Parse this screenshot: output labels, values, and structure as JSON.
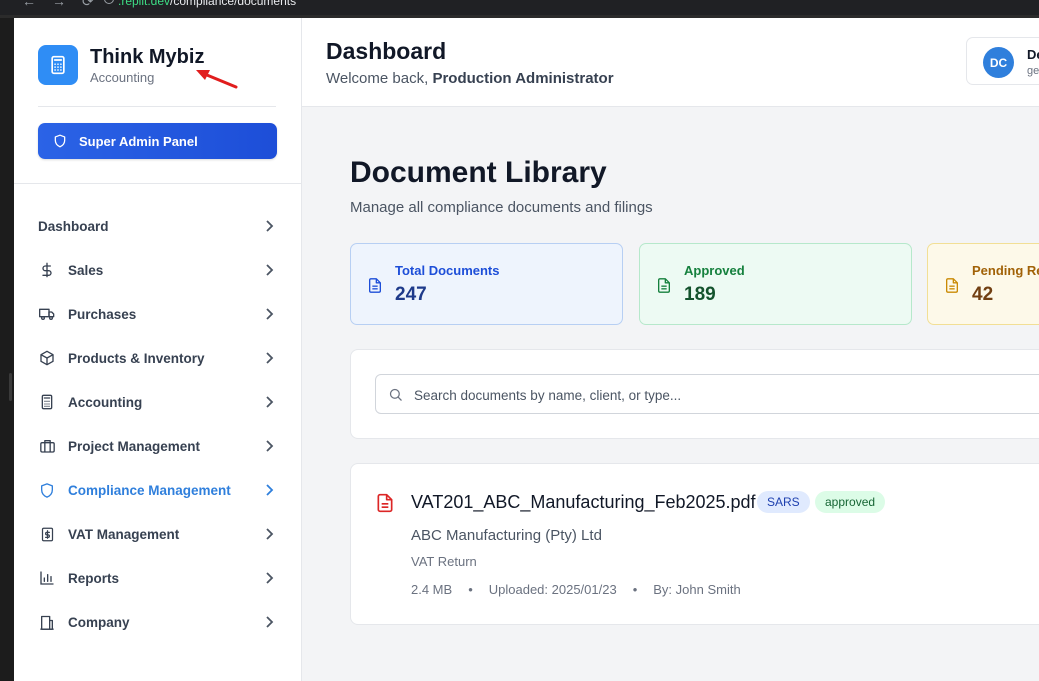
{
  "browser": {
    "url_host": ".replit.dev",
    "url_path": "/compliance/documents"
  },
  "brand": {
    "name": "Think Mybiz",
    "subtitle": "Accounting"
  },
  "admin_button": {
    "label": "Super Admin Panel"
  },
  "sidebar": {
    "items": [
      {
        "label": "Dashboard",
        "icon": "none",
        "active": false
      },
      {
        "label": "Sales",
        "icon": "dollar-icon",
        "active": false
      },
      {
        "label": "Purchases",
        "icon": "truck-icon",
        "active": false
      },
      {
        "label": "Products & Inventory",
        "icon": "box-icon",
        "active": false
      },
      {
        "label": "Accounting",
        "icon": "calculator-icon",
        "active": false
      },
      {
        "label": "Project Management",
        "icon": "briefcase-icon",
        "active": false
      },
      {
        "label": "Compliance Management",
        "icon": "shield-icon",
        "active": true
      },
      {
        "label": "VAT Management",
        "icon": "receipt-icon",
        "active": false
      },
      {
        "label": "Reports",
        "icon": "bar-chart-icon",
        "active": false
      },
      {
        "label": "Company",
        "icon": "building-icon",
        "active": false
      }
    ]
  },
  "header": {
    "title": "Dashboard",
    "welcome_prefix": "Welcome back, ",
    "welcome_name": "Production Administrator"
  },
  "user": {
    "initials": "DC",
    "name": "De",
    "email": "ge"
  },
  "library": {
    "title": "Document Library",
    "subtitle": "Manage all compliance documents and filings"
  },
  "stats": [
    {
      "label": "Total Documents",
      "value": "247",
      "color": "#1d4ed8"
    },
    {
      "label": "Approved",
      "value": "189",
      "color": "#15803d"
    },
    {
      "label": "Pending Re",
      "value": "42",
      "color": "#a16207"
    }
  ],
  "search": {
    "placeholder": "Search documents by name, client, or type...",
    "value": ""
  },
  "documents": [
    {
      "name": "VAT201_ABC_Manufacturing_Feb2025.pdf",
      "authority": "SARS",
      "status": "approved",
      "client": "ABC Manufacturing (Pty) Ltd",
      "type": "VAT Return",
      "size": "2.4 MB",
      "uploaded": "Uploaded: 2025/01/23",
      "by": "By: John Smith",
      "separator": "•"
    }
  ],
  "colors": {
    "accent": "#2f7fdc",
    "admin_button": "#1d4ed8",
    "annotation_arrow": "#e11d1d"
  }
}
